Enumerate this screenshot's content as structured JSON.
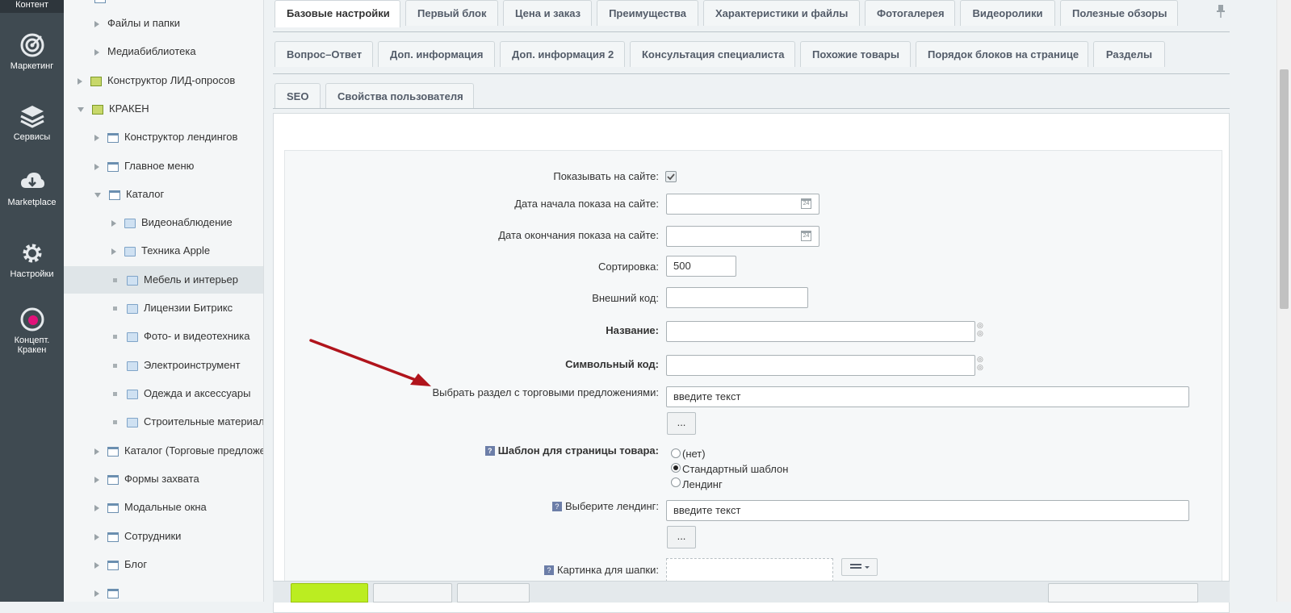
{
  "rail": {
    "top_label": "Контент",
    "items": [
      {
        "label": "Маркетинг",
        "icon": "target-icon"
      },
      {
        "label": "Сервисы",
        "icon": "layers-icon"
      },
      {
        "label": "Marketplace",
        "icon": "cloud-download-icon"
      },
      {
        "label": "Настройки",
        "icon": "gear-icon"
      },
      {
        "label1": "Концепт.",
        "label2": "Кракен",
        "icon": "kraken-logo-icon"
      }
    ]
  },
  "tree": {
    "items": [
      {
        "label": "Файлы и папки"
      },
      {
        "label": "Медиабиблиотека"
      },
      {
        "label": "Конструктор ЛИД-опросов"
      },
      {
        "label": "КРАКЕН"
      },
      {
        "label": "Конструктор лендингов"
      },
      {
        "label": "Главное меню"
      },
      {
        "label": "Каталог"
      },
      {
        "label": "Видеонаблюдение"
      },
      {
        "label": "Техника Apple"
      },
      {
        "label": "Мебель и интерьер"
      },
      {
        "label": "Лицензии Битрикс"
      },
      {
        "label": "Фото- и видеотехника"
      },
      {
        "label": "Электроинструмент"
      },
      {
        "label": "Одежда и аксессуары"
      },
      {
        "label": "Строительные материалы"
      },
      {
        "label": "Каталог (Торговые предложения)"
      },
      {
        "label": "Формы захвата"
      },
      {
        "label": "Модальные окна"
      },
      {
        "label": "Сотрудники"
      },
      {
        "label": "Блог"
      }
    ]
  },
  "tabs": {
    "row1": [
      "Базовые настройки",
      "Первый блок",
      "Цена и заказ",
      "Преимущества",
      "Характеристики и файлы",
      "Фотогалерея",
      "Видеоролики",
      "Полезные обзоры"
    ],
    "row2": [
      "Вопрос–Ответ",
      "Доп. информация",
      "Доп. информация 2",
      "Консультация специалиста",
      "Похожие товары",
      "Порядок блоков на странице",
      "Разделы"
    ],
    "row3": [
      "SEO",
      "Свойства пользователя"
    ]
  },
  "form": {
    "show_on_site": "Показывать на сайте:",
    "date_start": "Дата начала показа на сайте:",
    "date_end": "Дата окончания показа на сайте:",
    "sort_label": "Сортировка:",
    "sort_value": "500",
    "ext_code": "Внешний код:",
    "name": "Название:",
    "code": "Символьный код:",
    "offers_section": "Выбрать раздел с торговыми предложениями:",
    "offers_value": "введите текст",
    "dots": "...",
    "template_label": "Шаблон для страницы товара",
    "template_options": [
      "(нет)",
      "Стандартный шаблон",
      "Лендинг"
    ],
    "landing_label": "Выберите лендинг:",
    "landing_value": "введите текст",
    "header_image": "Картинка для шапки:",
    "help": "?",
    "cal_day": "24"
  }
}
